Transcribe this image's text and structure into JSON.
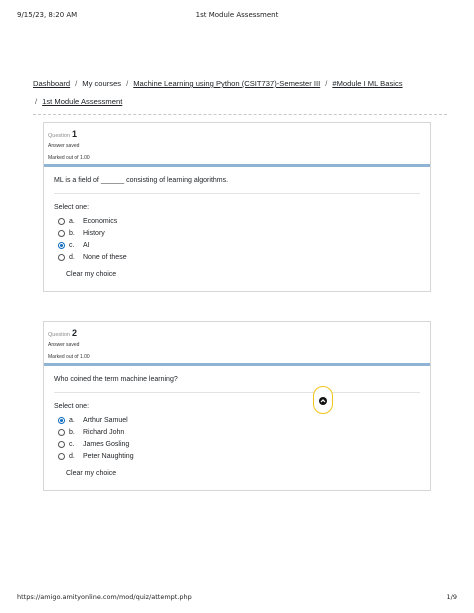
{
  "print_header": {
    "date": "9/15/23, 8:20 AM",
    "title": "1st Module Assessment"
  },
  "breadcrumb": {
    "items": [
      {
        "label": "Dashboard",
        "link": true
      },
      {
        "label": "My courses",
        "link": false
      },
      {
        "label": "Machine Learning using Python (CSIT737)-Semester III",
        "link": true
      },
      {
        "label": "#Module I ML Basics",
        "link": true
      },
      {
        "label": "1st Module Assessment",
        "link": true
      }
    ],
    "separator": "/"
  },
  "questions": [
    {
      "label": "Question",
      "number": "1",
      "state": "Answer saved",
      "marks": "Marked out of 1.00",
      "text": "ML is a field of ______ consisting of learning algorithms.",
      "select_one": "Select one:",
      "answers": [
        {
          "letter": "a.",
          "text": "Economics",
          "checked": false
        },
        {
          "letter": "b.",
          "text": "History",
          "checked": false
        },
        {
          "letter": "c.",
          "text": "AI",
          "checked": true
        },
        {
          "letter": "d.",
          "text": "None of these",
          "checked": false
        }
      ],
      "clear": "Clear my choice"
    },
    {
      "label": "Question",
      "number": "2",
      "state": "Answer saved",
      "marks": "Marked out of 1.00",
      "text": "Who coined the term machine learning?",
      "select_one": "Select one:",
      "answers": [
        {
          "letter": "a.",
          "text": "Arthur Samuel",
          "checked": true
        },
        {
          "letter": "b.",
          "text": "Richard John",
          "checked": false
        },
        {
          "letter": "c.",
          "text": "James Gosling",
          "checked": false
        },
        {
          "letter": "d.",
          "text": "Peter Naughting",
          "checked": false
        }
      ],
      "clear": "Clear my choice"
    }
  ],
  "scroll_top_icon": "chevron-up-icon",
  "print_footer": {
    "url": "https://amigo.amityonline.com/mod/quiz/attempt.php",
    "page": "1/9"
  },
  "colors": {
    "accent": "#0f6cbf",
    "question_bar": "#8fb4d3",
    "scroll_button_border": "#f0c419"
  }
}
